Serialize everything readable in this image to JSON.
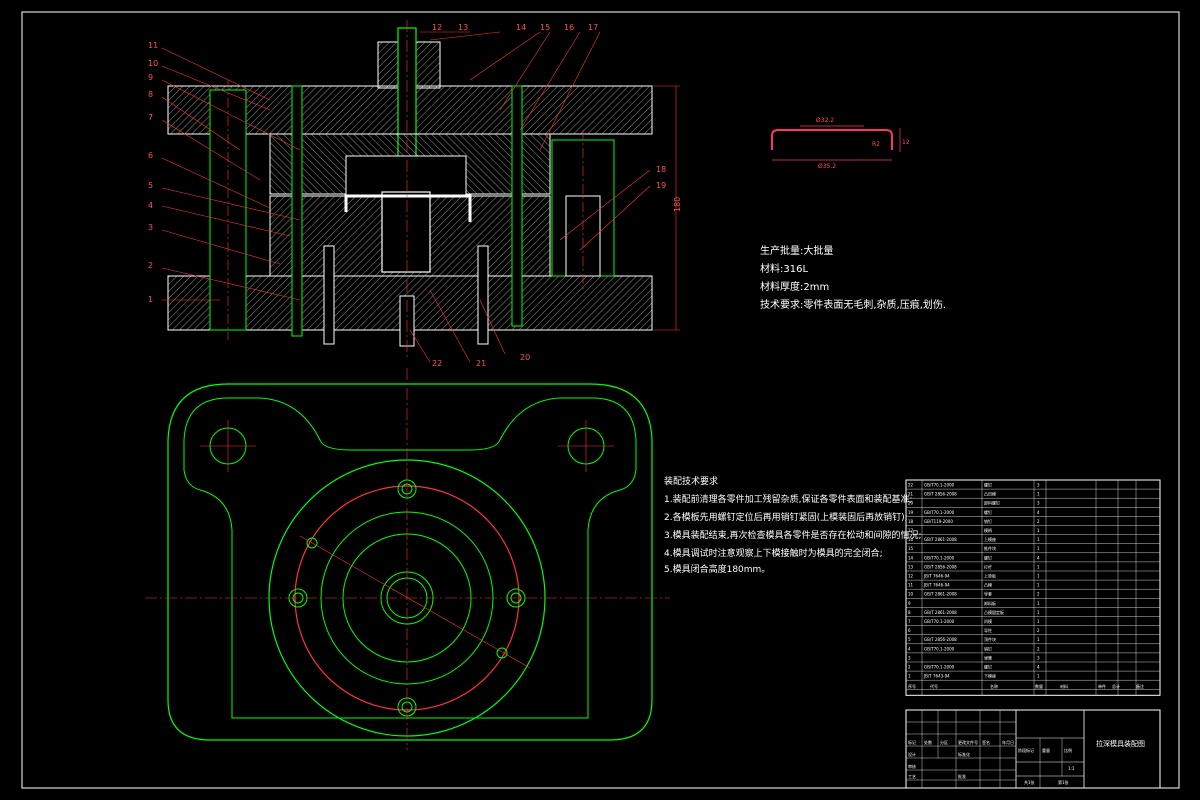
{
  "production": {
    "line1": "生产批量:大批量",
    "line2": "材料:316L",
    "line3": "材料厚度:2mm",
    "line4": "技术要求:零件表面无毛刺,杂质,压痕,划伤."
  },
  "assembly": {
    "title": "装配技术要求",
    "items": [
      "1.装配前清理各零件加工残留杂质,保证各零件表面和装配基准;",
      "2.各模板先用螺钉定位后再用销钉紧固(上模装固后再放销钉);",
      "3.模具装配结束,再次检查模具各零件是否存在松动和间隙的情况;",
      "4.模具调试时注意观察上下模接触时为模具的完全闭合;",
      "5.模具闭合高度180mm。"
    ]
  },
  "part_labels": [
    "1",
    "2",
    "3",
    "4",
    "5",
    "6",
    "7",
    "8",
    "9",
    "10",
    "11",
    "12",
    "13",
    "14",
    "15",
    "16",
    "17",
    "18",
    "19",
    "20",
    "21",
    "22"
  ],
  "part_dims": {
    "top": "Ø32.2",
    "right": "R2",
    "bottom": "Ø35.2",
    "side": "12"
  },
  "overall_height": "180",
  "bom": {
    "rows": [
      {
        "no": "22",
        "code": "GB/T70.1-2000",
        "name": "螺钉",
        "qty": "3"
      },
      {
        "no": "21",
        "code": "GB/T 2856-2008",
        "name": "凸凹模",
        "qty": "1"
      },
      {
        "no": "20",
        "code": "",
        "name": "卸料螺钉",
        "qty": "3"
      },
      {
        "no": "19",
        "code": "GB/T70.1-2000",
        "name": "螺钉",
        "qty": "4"
      },
      {
        "no": "18",
        "code": "GB/T119-2000",
        "name": "销钉",
        "qty": "2"
      },
      {
        "no": "17",
        "code": "",
        "name": "模柄",
        "qty": "1"
      },
      {
        "no": "16",
        "code": "GB/T 2861-2008",
        "name": "上模座",
        "qty": "1"
      },
      {
        "no": "15",
        "code": "",
        "name": "推件块",
        "qty": "1"
      },
      {
        "no": "14",
        "code": "GB/T70.1-2000",
        "name": "螺钉",
        "qty": "4"
      },
      {
        "no": "13",
        "code": "GB/T 2856-2008",
        "name": "打杆",
        "qty": "1"
      },
      {
        "no": "12",
        "code": "JB/T 7646-94",
        "name": "上垫板",
        "qty": "1"
      },
      {
        "no": "11",
        "code": "JB/T 7646-94",
        "name": "凸模",
        "qty": "1"
      },
      {
        "no": "10",
        "code": "GB/T 2861-2008",
        "name": "导套",
        "qty": "2"
      },
      {
        "no": "9",
        "code": "",
        "name": "卸料板",
        "qty": "1"
      },
      {
        "no": "8",
        "code": "GB/T 2861-2008",
        "name": "凸模固定板",
        "qty": "1"
      },
      {
        "no": "7",
        "code": "GB/T70.1-2000",
        "name": "凹模",
        "qty": "1"
      },
      {
        "no": "6",
        "code": "",
        "name": "导柱",
        "qty": "2"
      },
      {
        "no": "5",
        "code": "GB/T 2856-2008",
        "name": "顶件块",
        "qty": "1"
      },
      {
        "no": "4",
        "code": "GB/T70.1-2000",
        "name": "销钉",
        "qty": "2"
      },
      {
        "no": "3",
        "code": "",
        "name": "弹簧",
        "qty": "3"
      },
      {
        "no": "2",
        "code": "GB/T70.1-2000",
        "name": "螺钉",
        "qty": "4"
      },
      {
        "no": "1",
        "code": "JB/T 7643-94",
        "name": "下模座",
        "qty": "1"
      }
    ],
    "header": {
      "no": "序号",
      "code": "代号",
      "name": "名称",
      "qty": "数量",
      "material": "材料",
      "single": "单件",
      "total": "总计",
      "weight": "重量",
      "note": "备注"
    }
  },
  "title_block": {
    "drawing_name": "拉深模具装配图",
    "scale": "1:1",
    "sheet": "共1张",
    "sheet2": "第1张",
    "stage": "阶段标记",
    "weight_label": "重量",
    "scale_label": "比例",
    "design": "设计",
    "check": "审核",
    "process": "工艺",
    "approve": "批准",
    "mark": "标记",
    "count": "处数",
    "zone": "分区",
    "change_doc": "更改文件号",
    "sign": "签名",
    "date": "年月日",
    "std": "标准化"
  },
  "colors": {
    "outline": "#00ff00",
    "hatch": "#ffffff",
    "dimension": "#ff3333",
    "text": "#ffffff",
    "background": "#000000"
  }
}
